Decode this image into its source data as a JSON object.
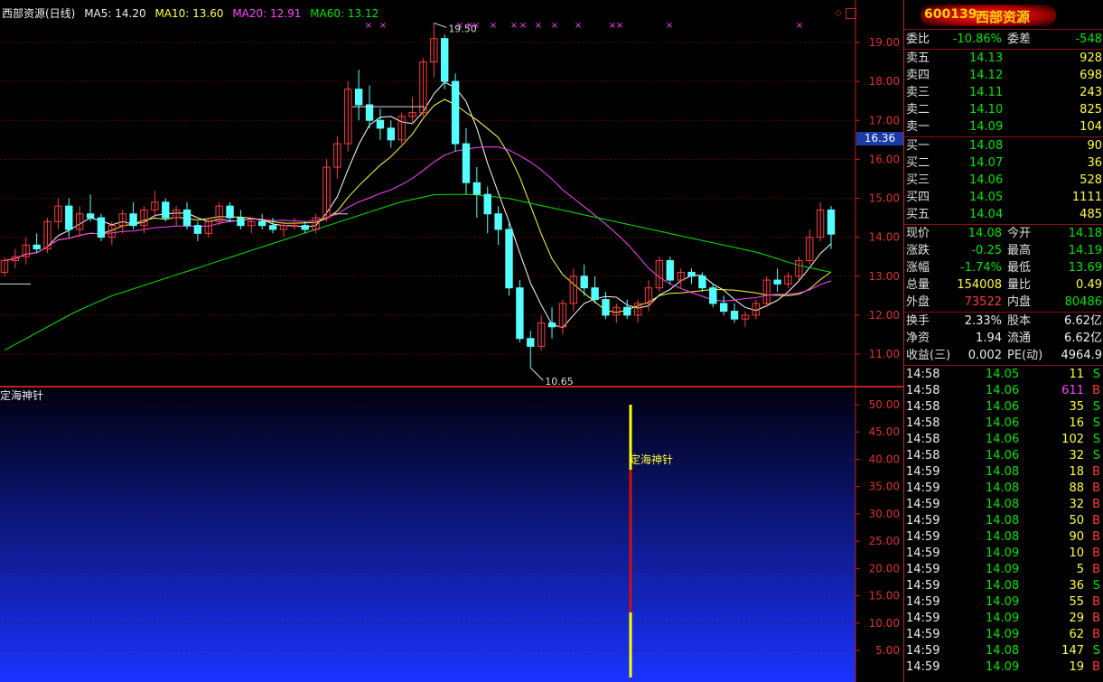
{
  "header": {
    "name": "西部资源(日线)",
    "ma5": "MA5: 14.20",
    "ma10": "MA10: 13.60",
    "ma20": "MA20: 12.91",
    "ma60": "MA60: 13.12"
  },
  "colors": {
    "up": "#ff3b3b",
    "down": "#54ffff",
    "ma5": "#ffffff",
    "ma10": "#ffff3c",
    "ma20": "#ff44ff",
    "ma60": "#00e600",
    "grid": "#6a0000",
    "axis": "#c02020"
  },
  "price_axis": {
    "ticks": [
      "19.00",
      "18.00",
      "17.00",
      "16.00",
      "15.00",
      "14.00",
      "13.00",
      "12.00",
      "11.00"
    ]
  },
  "current_price_box": "16.36",
  "high_label": "19.50",
  "low_label": "10.65",
  "indicator": {
    "name": "定海神针",
    "marker_label": "定海神针",
    "ticks": [
      "50.00",
      "45.00",
      "40.00",
      "35.00",
      "30.00",
      "25.00",
      "20.00",
      "15.00",
      "10.00",
      "5.00"
    ],
    "bar_value": 50
  },
  "chart_data": {
    "type": "candlestick",
    "y_range": [
      10.5,
      19.7
    ],
    "candles": [
      [
        13.1,
        13.5,
        13.0,
        13.4
      ],
      [
        13.4,
        13.7,
        13.2,
        13.5
      ],
      [
        13.5,
        14.0,
        13.3,
        13.8
      ],
      [
        13.8,
        14.1,
        13.6,
        13.7
      ],
      [
        13.7,
        14.5,
        13.6,
        14.4
      ],
      [
        14.4,
        15.0,
        14.2,
        14.8
      ],
      [
        14.8,
        15.0,
        14.0,
        14.2
      ],
      [
        14.2,
        14.8,
        14.0,
        14.6
      ],
      [
        14.6,
        15.1,
        14.4,
        14.5
      ],
      [
        14.5,
        14.6,
        13.9,
        14.0
      ],
      [
        14.0,
        14.4,
        13.8,
        14.3
      ],
      [
        14.3,
        14.7,
        14.1,
        14.6
      ],
      [
        14.6,
        14.9,
        14.2,
        14.3
      ],
      [
        14.3,
        14.8,
        14.1,
        14.7
      ],
      [
        14.7,
        15.2,
        14.5,
        14.9
      ],
      [
        14.9,
        15.0,
        14.4,
        14.5
      ],
      [
        14.5,
        14.8,
        14.3,
        14.7
      ],
      [
        14.7,
        14.9,
        14.2,
        14.3
      ],
      [
        14.3,
        14.4,
        13.9,
        14.1
      ],
      [
        14.1,
        14.5,
        14.0,
        14.4
      ],
      [
        14.4,
        14.9,
        14.3,
        14.8
      ],
      [
        14.8,
        14.9,
        14.4,
        14.5
      ],
      [
        14.5,
        14.7,
        14.2,
        14.3
      ],
      [
        14.3,
        14.5,
        14.1,
        14.4
      ],
      [
        14.4,
        14.6,
        14.2,
        14.3
      ],
      [
        14.3,
        14.5,
        14.1,
        14.2
      ],
      [
        14.2,
        14.4,
        14.0,
        14.3
      ],
      [
        14.3,
        14.5,
        14.2,
        14.3
      ],
      [
        14.3,
        14.4,
        14.1,
        14.2
      ],
      [
        14.2,
        14.6,
        14.1,
        14.5
      ],
      [
        14.5,
        16.0,
        14.4,
        15.8
      ],
      [
        15.8,
        16.6,
        15.5,
        16.4
      ],
      [
        16.4,
        18.0,
        16.2,
        17.8
      ],
      [
        17.8,
        18.3,
        17.0,
        17.4
      ],
      [
        17.4,
        17.9,
        16.8,
        17.0
      ],
      [
        17.0,
        17.3,
        16.5,
        16.8
      ],
      [
        16.8,
        17.0,
        16.3,
        16.5
      ],
      [
        16.5,
        17.2,
        16.4,
        17.1
      ],
      [
        17.1,
        17.6,
        16.9,
        17.2
      ],
      [
        17.2,
        18.6,
        17.1,
        18.5
      ],
      [
        18.5,
        19.5,
        18.1,
        19.1
      ],
      [
        19.1,
        19.2,
        17.8,
        18.0
      ],
      [
        18.0,
        18.2,
        16.2,
        16.4
      ],
      [
        16.4,
        16.8,
        15.1,
        15.4
      ],
      [
        15.4,
        15.8,
        14.5,
        15.1
      ],
      [
        15.1,
        15.3,
        14.1,
        14.6
      ],
      [
        14.6,
        14.8,
        13.8,
        14.2
      ],
      [
        14.2,
        14.4,
        12.5,
        12.7
      ],
      [
        12.7,
        12.9,
        11.3,
        11.4
      ],
      [
        11.4,
        11.6,
        10.65,
        11.2
      ],
      [
        11.2,
        12.0,
        11.1,
        11.8
      ],
      [
        11.8,
        12.2,
        11.4,
        11.7
      ],
      [
        11.7,
        12.4,
        11.5,
        12.3
      ],
      [
        12.3,
        13.2,
        12.1,
        13.0
      ],
      [
        13.0,
        13.3,
        12.5,
        12.7
      ],
      [
        12.7,
        13.0,
        12.3,
        12.4
      ],
      [
        12.4,
        12.6,
        11.9,
        12.0
      ],
      [
        12.0,
        12.3,
        11.8,
        12.2
      ],
      [
        12.2,
        12.4,
        11.9,
        12.0
      ],
      [
        12.0,
        12.4,
        11.8,
        12.3
      ],
      [
        12.3,
        12.9,
        12.1,
        12.7
      ],
      [
        12.7,
        13.5,
        12.6,
        13.4
      ],
      [
        13.4,
        13.5,
        12.8,
        12.9
      ],
      [
        12.9,
        13.2,
        12.7,
        13.1
      ],
      [
        13.1,
        13.2,
        12.8,
        13.0
      ],
      [
        13.0,
        13.1,
        12.6,
        12.7
      ],
      [
        12.7,
        12.8,
        12.2,
        12.3
      ],
      [
        12.3,
        12.5,
        12.0,
        12.1
      ],
      [
        12.1,
        12.3,
        11.8,
        11.9
      ],
      [
        11.9,
        12.1,
        11.7,
        12.0
      ],
      [
        12.0,
        12.4,
        11.9,
        12.3
      ],
      [
        12.3,
        13.0,
        12.2,
        12.9
      ],
      [
        12.9,
        13.2,
        12.6,
        12.8
      ],
      [
        12.8,
        13.1,
        12.7,
        13.0
      ],
      [
        13.0,
        13.5,
        12.9,
        13.4
      ],
      [
        13.4,
        14.2,
        13.3,
        14.0
      ],
      [
        14.0,
        14.9,
        13.9,
        14.7
      ],
      [
        14.7,
        14.8,
        13.7,
        14.08
      ]
    ],
    "ma_note": "MA5 white, MA10 yellow, MA20 magenta, MA60 green"
  },
  "panel": {
    "code": "600139",
    "name": "西部资源",
    "weibi": {
      "label": "委比",
      "value": "-10.86%",
      "label2": "委差",
      "value2": "-548"
    },
    "sells": [
      {
        "label": "卖五",
        "price": "14.13",
        "vol": "928"
      },
      {
        "label": "卖四",
        "price": "14.12",
        "vol": "698"
      },
      {
        "label": "卖三",
        "price": "14.11",
        "vol": "243"
      },
      {
        "label": "卖二",
        "price": "14.10",
        "vol": "825"
      },
      {
        "label": "卖一",
        "price": "14.09",
        "vol": "104"
      }
    ],
    "buys": [
      {
        "label": "买一",
        "price": "14.08",
        "vol": "90"
      },
      {
        "label": "买二",
        "price": "14.07",
        "vol": "36"
      },
      {
        "label": "买三",
        "price": "14.06",
        "vol": "528"
      },
      {
        "label": "买四",
        "price": "14.05",
        "vol": "1111"
      },
      {
        "label": "买五",
        "price": "14.04",
        "vol": "485"
      }
    ],
    "stats": [
      {
        "l1": "现价",
        "v1": "14.08",
        "c1": "g",
        "l2": "今开",
        "v2": "14.18",
        "c2": "g"
      },
      {
        "l1": "涨跌",
        "v1": "-0.25",
        "c1": "g",
        "l2": "最高",
        "v2": "14.19",
        "c2": "g"
      },
      {
        "l1": "涨幅",
        "v1": "-1.74%",
        "c1": "g",
        "l2": "最低",
        "v2": "13.69",
        "c2": "g"
      },
      {
        "l1": "总量",
        "v1": "154008",
        "c1": "y",
        "l2": "量比",
        "v2": "0.49",
        "c2": "y"
      },
      {
        "l1": "外盘",
        "v1": "73522",
        "c1": "r",
        "l2": "内盘",
        "v2": "80486",
        "c2": "g"
      }
    ],
    "stats2": [
      {
        "l1": "换手",
        "v1": "2.33%",
        "l2": "股本",
        "v2": "6.62亿"
      },
      {
        "l1": "净资",
        "v1": "1.94",
        "l2": "流通",
        "v2": "6.62亿"
      },
      {
        "l1": "收益(三)",
        "v1": "0.002",
        "l2": "PE(动)",
        "v2": "4964.9"
      }
    ],
    "ticks": [
      {
        "t": "14:58",
        "p": "14.05",
        "v": "11",
        "vc": "y",
        "s": "S"
      },
      {
        "t": "14:58",
        "p": "14.06",
        "v": "611",
        "vc": "m",
        "s": "B"
      },
      {
        "t": "14:58",
        "p": "14.06",
        "v": "35",
        "vc": "y",
        "s": "S"
      },
      {
        "t": "14:58",
        "p": "14.06",
        "v": "16",
        "vc": "y",
        "s": "S"
      },
      {
        "t": "14:58",
        "p": "14.06",
        "v": "102",
        "vc": "y",
        "s": "S"
      },
      {
        "t": "14:58",
        "p": "14.06",
        "v": "32",
        "vc": "y",
        "s": "S"
      },
      {
        "t": "14:59",
        "p": "14.08",
        "v": "18",
        "vc": "y",
        "s": "B"
      },
      {
        "t": "14:59",
        "p": "14.08",
        "v": "88",
        "vc": "y",
        "s": "B"
      },
      {
        "t": "14:59",
        "p": "14.08",
        "v": "32",
        "vc": "y",
        "s": "B"
      },
      {
        "t": "14:59",
        "p": "14.08",
        "v": "50",
        "vc": "y",
        "s": "B"
      },
      {
        "t": "14:59",
        "p": "14.08",
        "v": "90",
        "vc": "y",
        "s": "B"
      },
      {
        "t": "14:59",
        "p": "14.09",
        "v": "10",
        "vc": "y",
        "s": "B"
      },
      {
        "t": "14:59",
        "p": "14.09",
        "v": "5",
        "vc": "y",
        "s": "B"
      },
      {
        "t": "14:59",
        "p": "14.08",
        "v": "36",
        "vc": "y",
        "s": "S"
      },
      {
        "t": "14:59",
        "p": "14.09",
        "v": "55",
        "vc": "y",
        "s": "B"
      },
      {
        "t": "14:59",
        "p": "14.09",
        "v": "29",
        "vc": "y",
        "s": "B"
      },
      {
        "t": "14:59",
        "p": "14.09",
        "v": "62",
        "vc": "y",
        "s": "B"
      },
      {
        "t": "14:59",
        "p": "14.08",
        "v": "147",
        "vc": "y",
        "s": "S"
      },
      {
        "t": "14:59",
        "p": "14.09",
        "v": "19",
        "vc": "y",
        "s": "B"
      }
    ]
  }
}
